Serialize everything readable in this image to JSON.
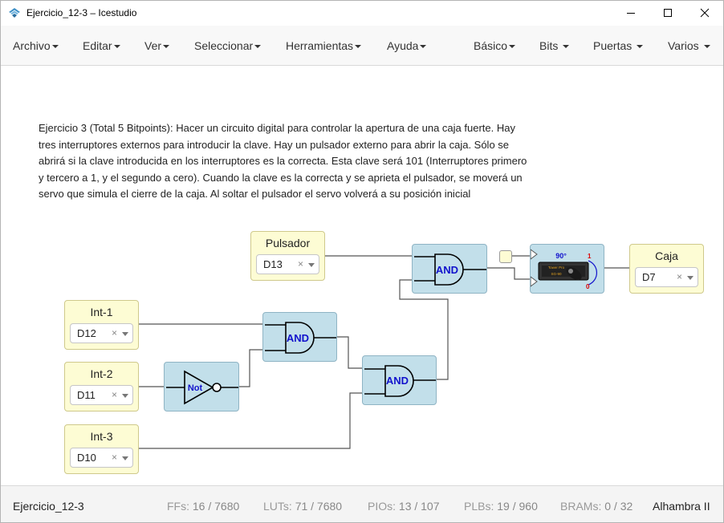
{
  "window": {
    "title": "Ejercicio_12-3 – Icestudio",
    "icon": "icestudio-logo-icon"
  },
  "menu": {
    "left": [
      "Archivo",
      "Editar",
      "Ver",
      "Seleccionar",
      "Herramientas",
      "Ayuda"
    ],
    "right": [
      "Básico",
      "Bits",
      "Puertas",
      "Varios"
    ]
  },
  "info": {
    "lines": [
      "Ejercicio 3 (Total 5 Bitpoints): Hacer un circuito digital para controlar la apertura de una caja fuerte. Hay",
      "tres interruptores externos para introducir la clave. Hay un pulsador externo para abrir la caja. Sólo se",
      "abrirá si la clave introducida en los interruptores es la correcta. Esta clave será 101 (Interruptores primero",
      "y tercero a 1, y el segundo a cero). Cuando la clave es la correcta y se aprieta el pulsador, se moverá un",
      "servo que simula el cierre de la caja. Al soltar el pulsador el servo volverá a su posición inicial"
    ]
  },
  "blocks": {
    "pulsador": {
      "label": "Pulsador",
      "pin": "D13"
    },
    "caja": {
      "label": "Caja",
      "pin": "D7"
    },
    "int1": {
      "label": "Int-1",
      "pin": "D12"
    },
    "int2": {
      "label": "Int-2",
      "pin": "D11"
    },
    "int3": {
      "label": "Int-3",
      "pin": "D10"
    },
    "clear_symbol": "×"
  },
  "gates": {
    "and_label": "AND",
    "not_label": "Not",
    "servo": {
      "angle": "90°",
      "top_value": "1",
      "bottom_value": "0",
      "brand": "Tower Pro",
      "model": "SG-90"
    }
  },
  "status": {
    "project": "Ejercicio_12-3",
    "ffs_label": "FFs:",
    "ffs_value": "16 / 7680",
    "luts_label": "LUTs:",
    "luts_value": "71 / 7680",
    "pios_label": "PIOs:",
    "pios_value": "13 / 107",
    "plbs_label": "PLBs:",
    "plbs_value": "19 / 960",
    "brams_label": "BRAMs:",
    "brams_value": "0 / 32",
    "board": "Alhambra II"
  },
  "colors": {
    "io_block": "#fdfcd4",
    "gate_block": "#c2dfea",
    "gate_text": "#1111cc",
    "wire": "#555555"
  }
}
